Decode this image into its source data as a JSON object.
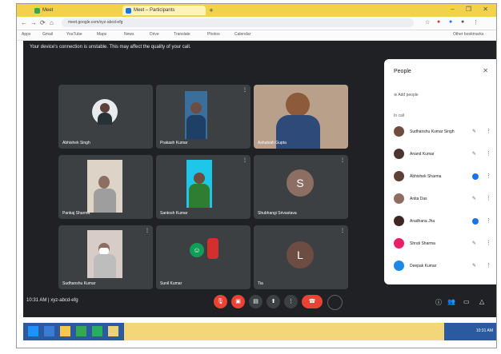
{
  "browser": {
    "tabs": [
      {
        "label": "Meet",
        "color": "#34a853"
      },
      {
        "label": "Meet – Participants",
        "color": "#1a73e8"
      }
    ],
    "new_tab": "+",
    "window_buttons": "– ❐ ✕",
    "address": "meet.google.com/xyz-abcd-efg",
    "bookmarks": [
      "Apps",
      "Gmail",
      "YouTube",
      "Maps",
      "News",
      "Drive",
      "Translate",
      "Photos",
      "Calendar"
    ],
    "other_bookmarks": "Other bookmarks"
  },
  "meet": {
    "banner": "Your device's connection is unstable. This may affect the quality of your call.",
    "tiles": [
      {
        "name": "Abhishek Singh"
      },
      {
        "name": "Prakash Kumar"
      },
      {
        "name": "Ashutosh Gupta"
      },
      {
        "name": "Pankaj Sharma"
      },
      {
        "name": "Santosh Kumar"
      },
      {
        "name": "Shubhangi Srivastava",
        "initial": "S"
      },
      {
        "name": "Sudhanshu Kumar",
        "initial": ""
      },
      {
        "name": "Sunil Kumar",
        "initial": ""
      },
      {
        "name": "Tia",
        "initial": "L"
      }
    ],
    "toolbar": {
      "time_label": "10:31 AM | xyz-abcd-efg"
    }
  },
  "people": {
    "title": "People",
    "add_people": "Add people",
    "in_call": "In call",
    "participants": [
      {
        "name": "Sudhanshu Kumar Singh",
        "color": "#6d4c41"
      },
      {
        "name": "Anand Kumar",
        "color": "#4e342e"
      },
      {
        "name": "Abhishek Sharma",
        "color": "#5d4037"
      },
      {
        "name": "Anita Das",
        "color": "#8d6e63"
      },
      {
        "name": "Aradhana Jha",
        "color": "#3e2723"
      },
      {
        "name": "Shruti Sharma",
        "color": "#e91e63"
      },
      {
        "name": "Deepak Kumar",
        "color": "#1e88e5"
      }
    ]
  },
  "taskbar": {
    "time": "10:31 AM"
  }
}
